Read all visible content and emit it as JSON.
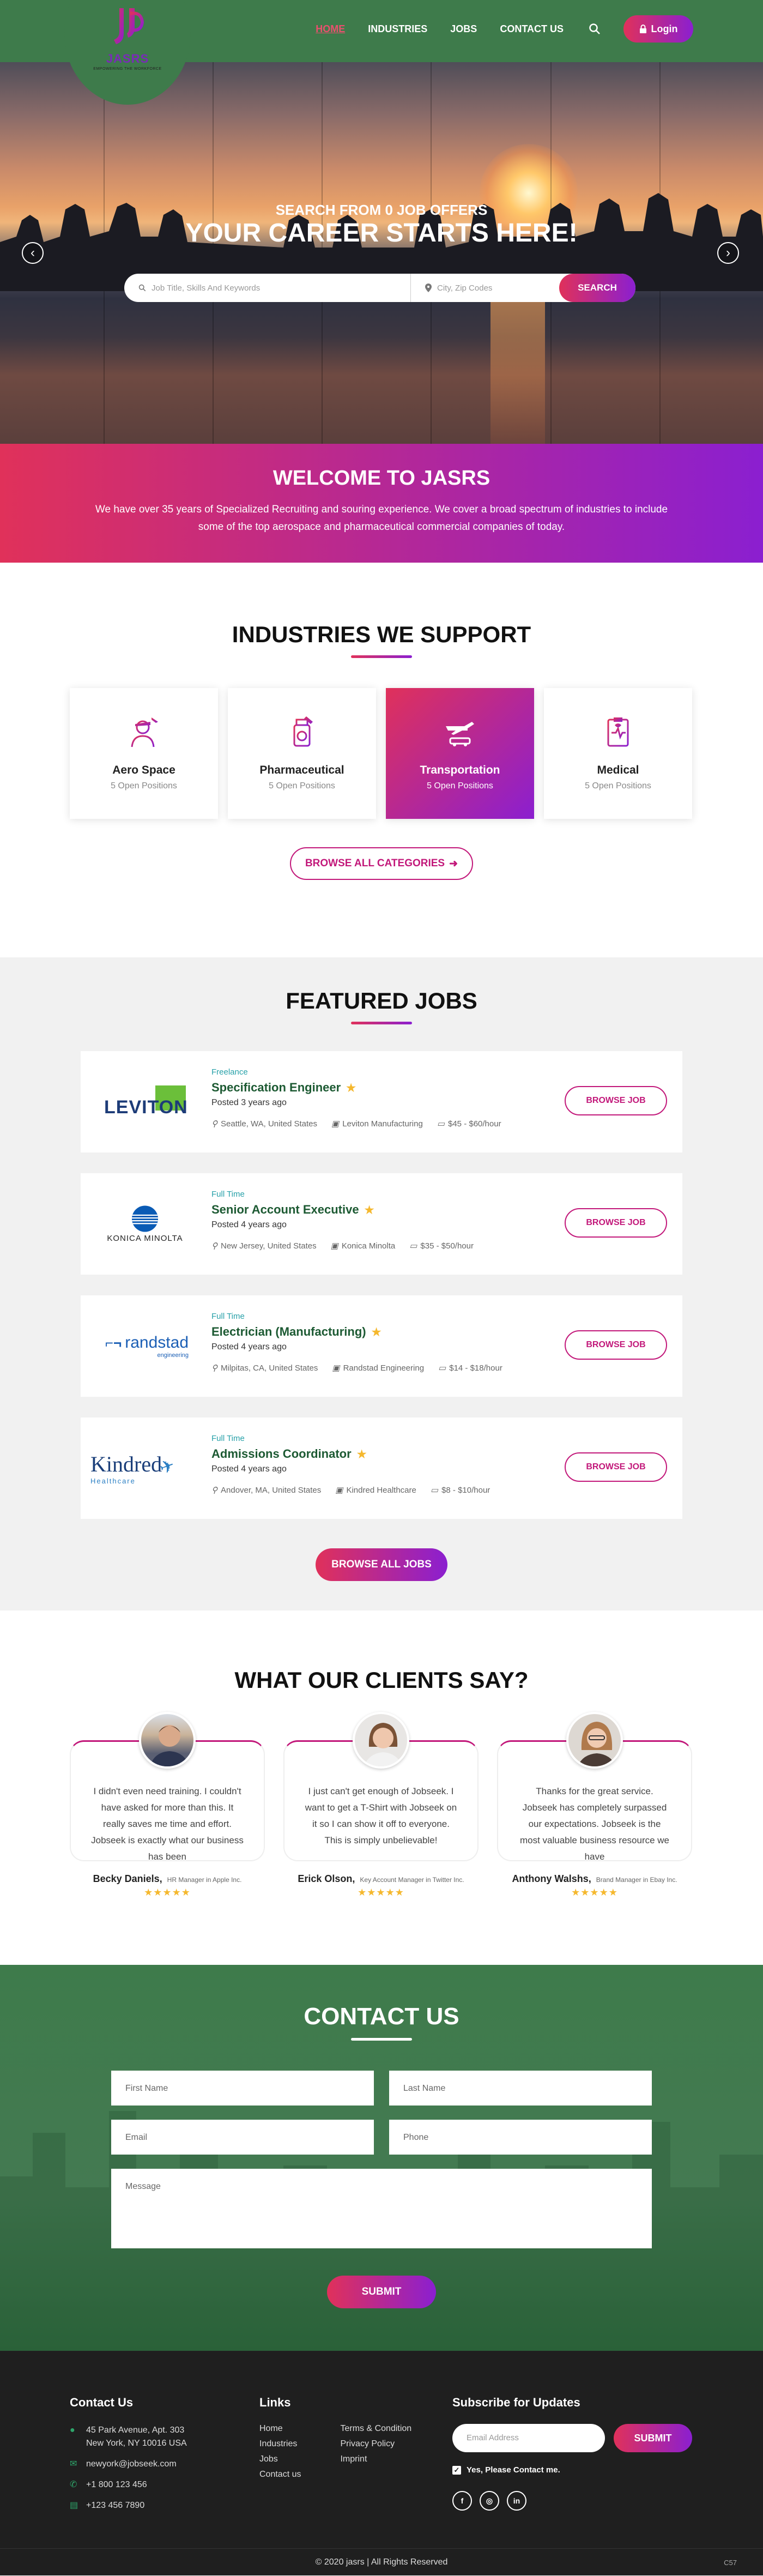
{
  "brand": {
    "name": "JASRS",
    "tagline": "EMPOWERING THE WORKFORCE"
  },
  "nav": {
    "items": [
      "HOME",
      "INDUSTRIES",
      "JOBS",
      "CONTACT US"
    ],
    "login": "Login"
  },
  "hero": {
    "subtitle": "SEARCH FROM 0 JOB OFFERS",
    "title": "YOUR CAREER STARTS HERE!",
    "keyword_placeholder": "Job Title, Skills And Keywords",
    "location_placeholder": "City, Zip Codes",
    "search_button": "SEARCH",
    "prev": "‹",
    "next": "›"
  },
  "welcome": {
    "title": "WELCOME TO JASRS",
    "text": "We have over 35 years of Specialized Recruiting and souring experience. We cover a broad spectrum of industries to include some of the top aerospace and pharmaceutical commercial companies of today."
  },
  "industries": {
    "title": "INDUSTRIES WE SUPPORT",
    "items": [
      {
        "name": "Aero Space",
        "positions": "5 Open Positions",
        "icon": "pilot-icon"
      },
      {
        "name": "Pharmaceutical",
        "positions": "5 Open Positions",
        "icon": "medicine-bottle-icon"
      },
      {
        "name": "Transportation",
        "positions": "5 Open Positions",
        "icon": "plane-car-icon"
      },
      {
        "name": "Medical",
        "positions": "5 Open Positions",
        "icon": "medical-clipboard-icon"
      }
    ],
    "browse": "BROWSE ALL CATEGORIES"
  },
  "featured": {
    "title": "FEATURED JOBS",
    "browse_label": "BROWSE JOB",
    "browse_all": "BROWSE ALL JOBS",
    "jobs": [
      {
        "type": "Freelance",
        "title": "Specification Engineer",
        "posted": "Posted 3 years ago",
        "location": "Seattle, WA, United States",
        "company": "Leviton Manufacturing",
        "salary": "$45 - $60/hour",
        "logo": "LEVITON"
      },
      {
        "type": "Full Time",
        "title": "Senior Account Executive",
        "posted": "Posted 4 years ago",
        "location": "New Jersey, United States",
        "company": "Konica Minolta",
        "salary": "$35 - $50/hour",
        "logo": "KONICA MINOLTA"
      },
      {
        "type": "Full Time",
        "title": "Electrician (Manufacturing)",
        "posted": "Posted 4 years ago",
        "location": "Milpitas, CA, United States",
        "company": "Randstad Engineering",
        "salary": "$14 - $18/hour",
        "logo": "randstad",
        "logo_sub": "engineering"
      },
      {
        "type": "Full Time",
        "title": "Admissions Coordinator",
        "posted": "Posted 4 years ago",
        "location": "Andover, MA, United States",
        "company": "Kindred Healthcare",
        "salary": "$8 - $10/hour",
        "logo": "Kindred",
        "logo_sub": "Healthcare"
      }
    ]
  },
  "testimonials": {
    "title": "WHAT OUR CLIENTS SAY?",
    "items": [
      {
        "text": "I didn't even need training. I couldn't have asked for more than this. It really saves me time and effort. Jobseek is exactly what our business has been",
        "name": "Becky Daniels,",
        "role": "HR Manager in Apple Inc.",
        "rating": 5
      },
      {
        "text": "I just can't get enough of Jobseek. I want to get a T-Shirt with Jobseek on it so I can show it off to everyone. This is simply unbelievable!",
        "name": "Erick Olson,",
        "role": "Key Account Manager in Twitter Inc.",
        "rating": 5
      },
      {
        "text": "Thanks for the great service. Jobseek has completely surpassed our expectations. Jobseek is the most valuable business resource we have",
        "name": "Anthony Walshs,",
        "role": "Brand Manager in Ebay Inc.",
        "rating": 5
      }
    ]
  },
  "contact": {
    "title": "CONTACT US",
    "first": "First Name",
    "last": "Last Name",
    "email": "Email",
    "phone": "Phone",
    "message": "Message",
    "submit": "SUBMIT"
  },
  "footer": {
    "contact_title": "Contact Us",
    "address": "45 Park Avenue, Apt. 303\nNew York, NY 10016 USA",
    "email": "newyork@jobseek.com",
    "phone": "+1 800 123 456",
    "fax": "+123 456 7890",
    "links_title": "Links",
    "links1": [
      "Home",
      "Industries",
      "Jobs",
      "Contact us"
    ],
    "links2": [
      "Terms & Condition",
      "Privacy Policy",
      "Imprint"
    ],
    "subscribe_title": "Subscribe for Updates",
    "email_placeholder": "Email Address",
    "submit": "SUBMIT",
    "consent": "Yes, Please Contact me.",
    "socials": [
      "f",
      "◎",
      "in"
    ],
    "copyright": "© 2020  jasrs  |  All Rights Reserved",
    "code": "C57"
  },
  "colors": {
    "header": "#3e7b4b",
    "accent_start": "#e0315a",
    "accent_end": "#8b1fd0",
    "footer": "#1f1f1f"
  }
}
